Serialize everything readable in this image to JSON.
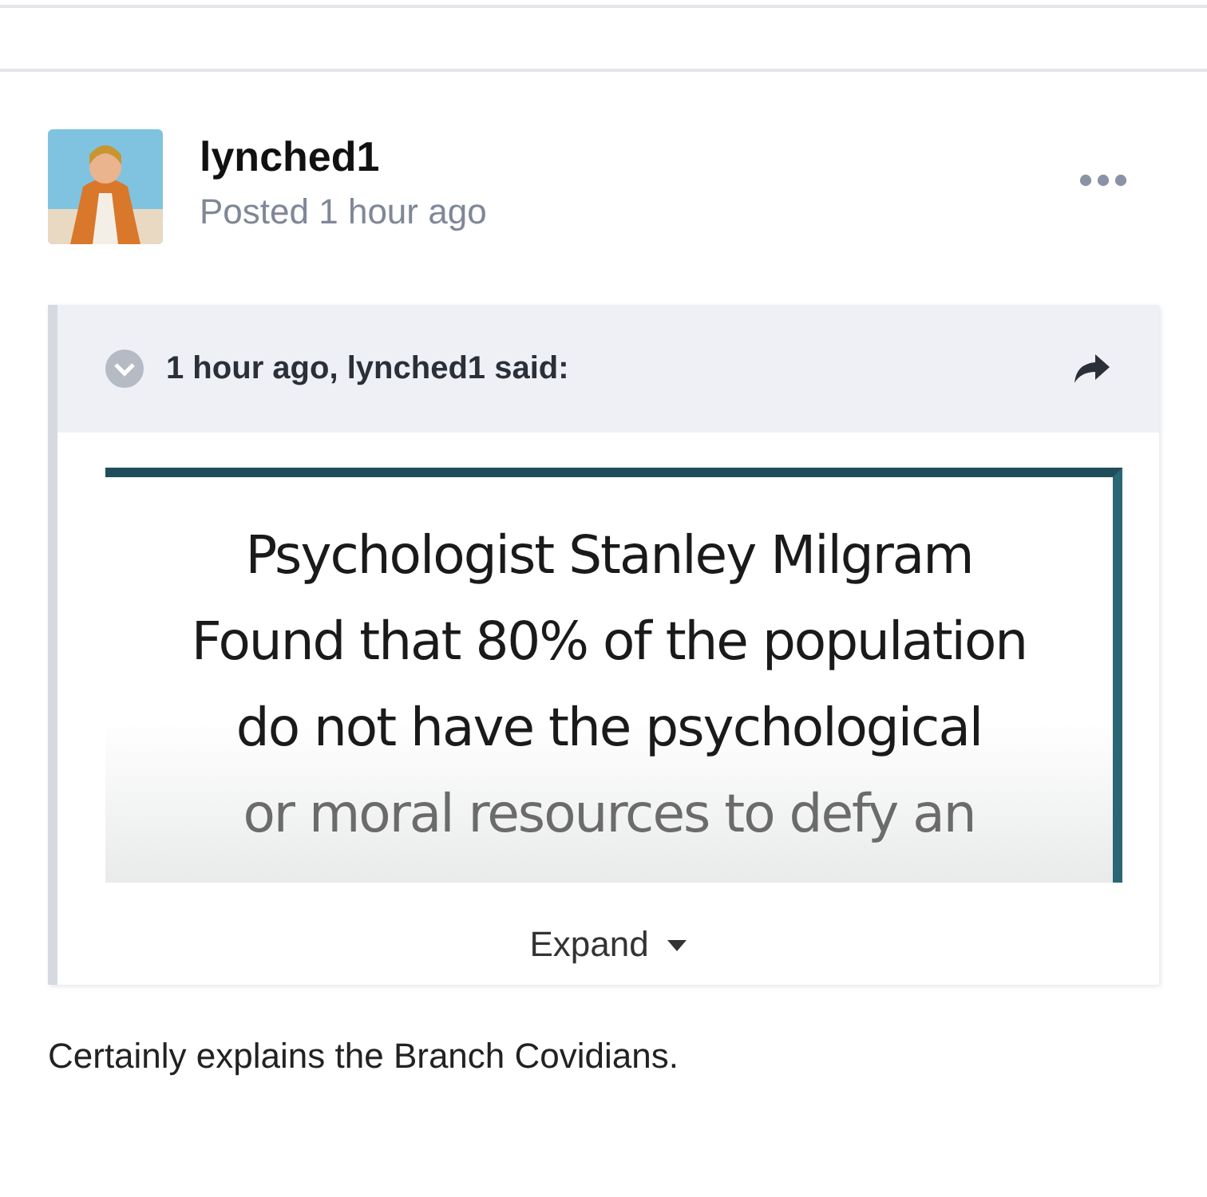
{
  "post": {
    "author": "lynched1",
    "meta": "Posted 1 hour ago"
  },
  "quote": {
    "header": "1 hour ago, lynched1 said:",
    "slide_lines": [
      "Psychologist Stanley Milgram",
      "Found that 80% of the population",
      "do not have the psychological",
      "or moral resources to defy an"
    ],
    "expand": "Expand"
  },
  "body": "Certainly explains the Branch Covidians."
}
